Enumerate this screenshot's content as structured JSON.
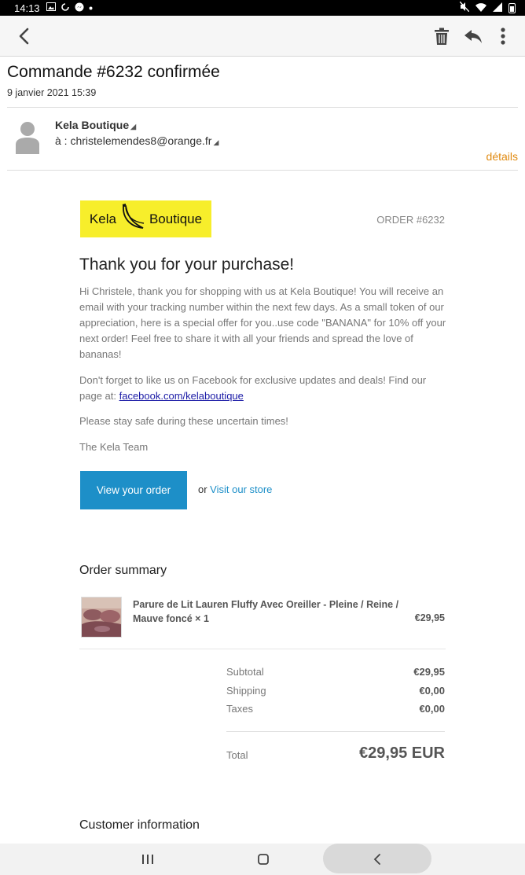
{
  "status_bar": {
    "time": "14:13"
  },
  "email": {
    "subject": "Commande #6232 confirmée",
    "date": "9 janvier 2021 15:39",
    "sender": "Kela Boutique",
    "recipient_prefix": "à : ",
    "recipient": "christelemendes8@orange.fr",
    "details_label": "détails"
  },
  "body": {
    "logo_left": "Kela",
    "logo_right": "Boutique",
    "order_number": "ORDER #6232",
    "heading": "Thank you for your purchase!",
    "paragraph1": "Hi Christele, thank you for shopping with us at Kela Boutique! You will receive an email with your tracking number within the next few days. As a small token of our appreciation, here is a special offer for you..use code \"BANANA\" for 10% off your next order! Feel free to share it with all your friends and spread the love of bananas!",
    "paragraph2_text": "Don't forget to like us on Facebook for exclusive updates and deals! Find our page at: ",
    "facebook_link": "facebook.com/kelaboutique",
    "paragraph3": "Please stay safe during these uncertain times!",
    "signature": "The Kela Team",
    "view_order_button": "View your order",
    "or_text": "or ",
    "visit_store_link": "Visit our store"
  },
  "order_summary": {
    "title": "Order summary",
    "item_name": "Parure de Lit Lauren Fluffy Avec Oreiller - Pleine / Reine / Mauve foncé × 1",
    "item_price": "€29,95",
    "subtotal_label": "Subtotal",
    "subtotal_value": "€29,95",
    "shipping_label": "Shipping",
    "shipping_value": "€0,00",
    "taxes_label": "Taxes",
    "taxes_value": "€0,00",
    "total_label": "Total",
    "total_value": "€29,95 EUR"
  },
  "customer_info": {
    "title": "Customer information"
  },
  "colors": {
    "accent": "#1d8fc8",
    "details": "#e08a10",
    "logo_bg": "#f7ee2b"
  },
  "icons": [
    "back-arrow-icon",
    "trash-icon",
    "reply-icon",
    "more-vert-icon",
    "avatar-icon",
    "banana-icon",
    "recent-apps-icon",
    "home-icon",
    "nav-back-icon"
  ]
}
